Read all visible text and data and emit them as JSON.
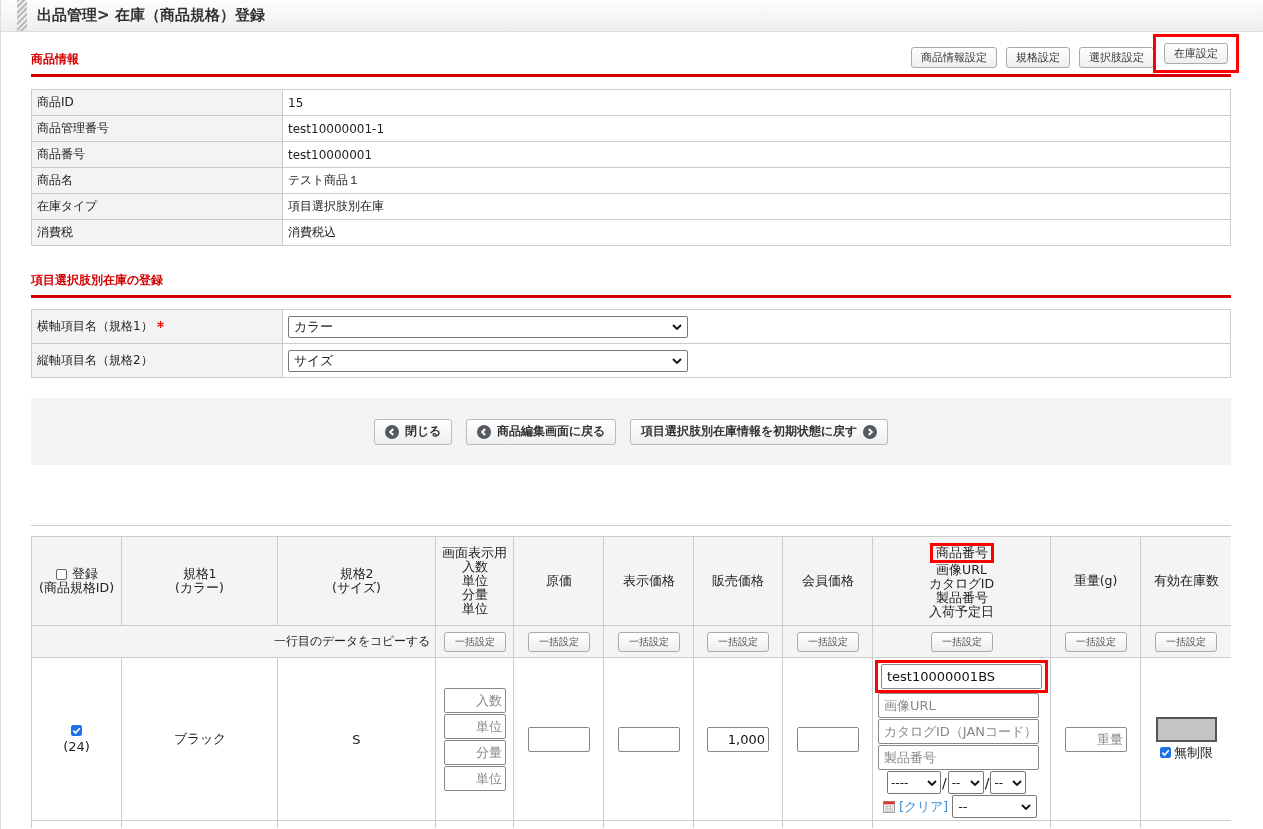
{
  "header": {
    "title": "出品管理> 在庫（商品規格）登録"
  },
  "product_info": {
    "title": "商品情報",
    "buttons": [
      {
        "label": "商品情報設定",
        "highlighted": false
      },
      {
        "label": "規格設定",
        "highlighted": false
      },
      {
        "label": "選択肢設定",
        "highlighted": false
      },
      {
        "label": "在庫設定",
        "highlighted": true
      }
    ],
    "rows": [
      {
        "label": "商品ID",
        "value": "15"
      },
      {
        "label": "商品管理番号",
        "value": "test10000001-1"
      },
      {
        "label": "商品番号",
        "value": "test10000001"
      },
      {
        "label": "商品名",
        "value": "テスト商品１"
      },
      {
        "label": "在庫タイプ",
        "value": "項目選択肢別在庫"
      },
      {
        "label": "消費税",
        "value": "消費税込"
      }
    ]
  },
  "stock_section": {
    "title": "項目選択肢別在庫の登録",
    "fields": [
      {
        "label": "横軸項目名（規格1）",
        "required": true,
        "value": "カラー"
      },
      {
        "label": "縦軸項目名（規格2）",
        "required": false,
        "value": "サイズ"
      }
    ]
  },
  "actions": [
    {
      "label": "閉じる",
      "kind": "back"
    },
    {
      "label": "商品編集画面に戻る",
      "kind": "back"
    },
    {
      "label": "項目選択肢別在庫情報を初期状態に戻す",
      "kind": "forward"
    }
  ],
  "table": {
    "select_all": {
      "checked": false
    },
    "columns": [
      {
        "lines": [
          {
            "text": "登録",
            "highlighted": false
          },
          {
            "text": "(商品規格ID)",
            "highlighted": false
          }
        ]
      },
      {
        "lines": [
          {
            "text": "規格1",
            "highlighted": false
          },
          {
            "text": "(カラー)",
            "highlighted": false
          }
        ]
      },
      {
        "lines": [
          {
            "text": "規格2",
            "highlighted": false
          },
          {
            "text": "(サイズ)",
            "highlighted": false
          }
        ]
      },
      {
        "lines": [
          {
            "text": "画面表示用",
            "highlighted": false
          },
          {
            "text": "入数",
            "highlighted": false
          },
          {
            "text": "単位",
            "highlighted": false
          },
          {
            "text": "分量",
            "highlighted": false
          },
          {
            "text": "単位",
            "highlighted": false
          }
        ]
      },
      {
        "lines": [
          {
            "text": "原価",
            "highlighted": false
          }
        ]
      },
      {
        "lines": [
          {
            "text": "表示価格",
            "highlighted": false
          }
        ]
      },
      {
        "lines": [
          {
            "text": "販売価格",
            "highlighted": false
          }
        ]
      },
      {
        "lines": [
          {
            "text": "会員価格",
            "highlighted": false
          }
        ]
      },
      {
        "lines": [
          {
            "text": "商品番号",
            "highlighted": true
          },
          {
            "text": "画像URL",
            "highlighted": false
          },
          {
            "text": "カタログID",
            "highlighted": false
          },
          {
            "text": "製品番号",
            "highlighted": false
          },
          {
            "text": "入荷予定日",
            "highlighted": false
          }
        ]
      },
      {
        "lines": [
          {
            "text": "重量(g)",
            "highlighted": false
          }
        ]
      },
      {
        "lines": [
          {
            "text": "有効在庫数",
            "highlighted": false
          }
        ]
      }
    ],
    "copy_label": "一行目のデータをコピーする",
    "bulk_buttons": [
      "一括設定",
      "一括設定",
      "一括設定",
      "一括設定",
      "一括設定",
      "一括設定",
      "一括設定",
      "一括設定"
    ],
    "rows": [
      {
        "checked": true,
        "id": "(24)",
        "spec1": "ブラック",
        "spec2": "S",
        "display_placeholders": [
          "入数",
          "単位",
          "分量",
          "単位"
        ],
        "cost": "",
        "display_price": "",
        "sale_price": "1,000",
        "member_price": "",
        "product_number": {
          "value": "test10000001BS",
          "highlighted": true
        },
        "detail_placeholders": [
          "画像URL",
          "カタログID（JANコード）",
          "製品番号"
        ],
        "date_selects": [
          "----",
          "--",
          "--"
        ],
        "date_separator": "/",
        "clear_link": "[クリア]",
        "time_select": "--",
        "weight_placeholder": "重量",
        "stock_disabled": true,
        "unlimited": {
          "checked": true,
          "label": "無制限"
        }
      }
    ]
  }
}
